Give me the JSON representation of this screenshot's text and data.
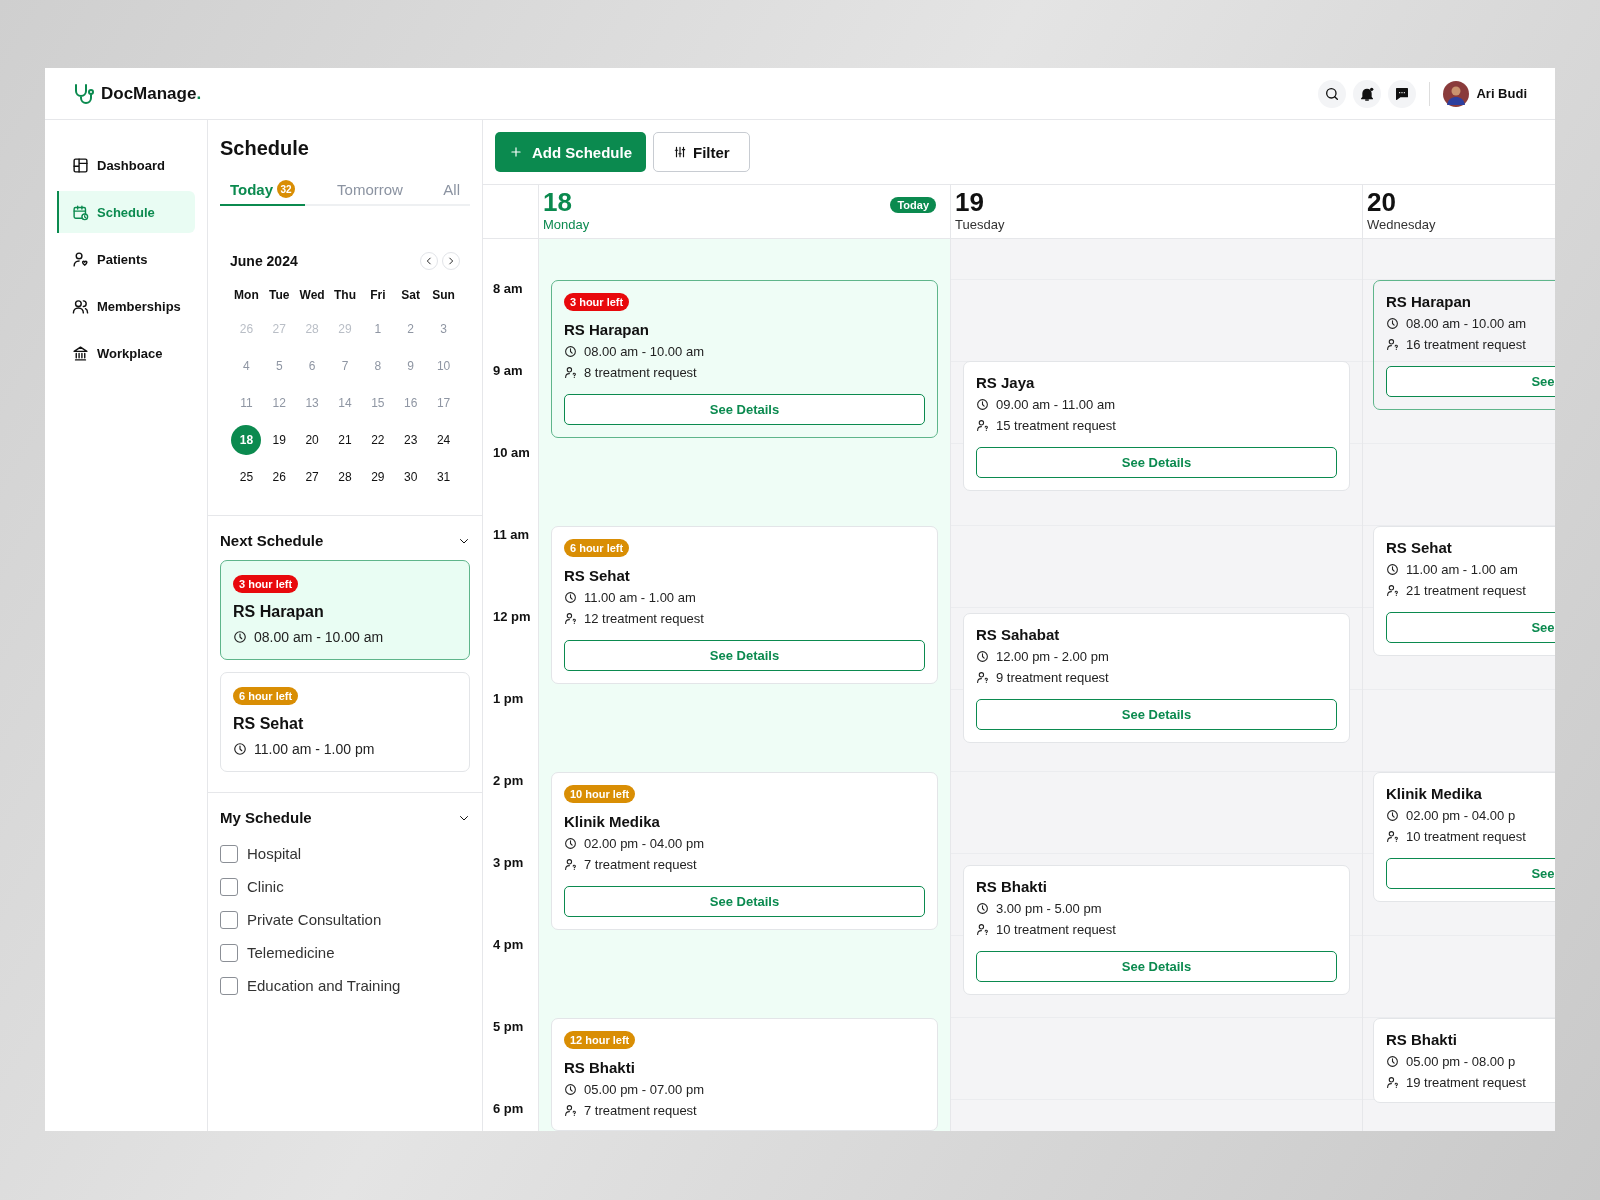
{
  "header": {
    "logo": "DocManage",
    "logo_dot": ".",
    "user": "Ari Budi"
  },
  "sidebar": {
    "items": [
      {
        "label": "Dashboard",
        "kind": "dashboard",
        "selected": false
      },
      {
        "label": "Schedule",
        "kind": "schedule",
        "selected": true
      },
      {
        "label": "Patients",
        "kind": "patients",
        "selected": false
      },
      {
        "label": "Memberships",
        "kind": "memberships",
        "selected": false
      },
      {
        "label": "Workplace",
        "kind": "workplace",
        "selected": false
      }
    ]
  },
  "schedule_panel": {
    "title": "Schedule",
    "tabs": [
      {
        "label": "Today",
        "count": "32",
        "selected": true
      },
      {
        "label": "Tomorrow",
        "selected": false
      },
      {
        "label": "All",
        "selected": false
      }
    ],
    "calendar": {
      "month": "June 2024",
      "weekdays": [
        "Mon",
        "Tue",
        "Wed",
        "Thu",
        "Fri",
        "Sat",
        "Sun"
      ],
      "days": [
        {
          "label": "26",
          "kind": "other",
          "selected": false
        },
        {
          "label": "27",
          "kind": "other",
          "selected": false
        },
        {
          "label": "28",
          "kind": "other",
          "selected": false
        },
        {
          "label": "29",
          "kind": "other",
          "selected": false
        },
        {
          "label": "1",
          "kind": "past",
          "selected": false
        },
        {
          "label": "2",
          "kind": "past",
          "selected": false
        },
        {
          "label": "3",
          "kind": "past",
          "selected": false
        },
        {
          "label": "4",
          "kind": "past",
          "selected": false
        },
        {
          "label": "5",
          "kind": "past",
          "selected": false
        },
        {
          "label": "6",
          "kind": "past",
          "selected": false
        },
        {
          "label": "7",
          "kind": "past",
          "selected": false
        },
        {
          "label": "8",
          "kind": "past",
          "selected": false
        },
        {
          "label": "9",
          "kind": "past",
          "selected": false
        },
        {
          "label": "10",
          "kind": "past",
          "selected": false
        },
        {
          "label": "11",
          "kind": "past",
          "selected": false
        },
        {
          "label": "12",
          "kind": "past",
          "selected": false
        },
        {
          "label": "13",
          "kind": "past",
          "selected": false
        },
        {
          "label": "14",
          "kind": "past",
          "selected": false
        },
        {
          "label": "15",
          "kind": "past",
          "selected": false
        },
        {
          "label": "16",
          "kind": "past",
          "selected": false
        },
        {
          "label": "17",
          "kind": "past",
          "selected": false
        },
        {
          "label": "18",
          "kind": "upcoming",
          "selected": true
        },
        {
          "label": "19",
          "kind": "upcoming",
          "selected": false
        },
        {
          "label": "20",
          "kind": "upcoming",
          "selected": false
        },
        {
          "label": "21",
          "kind": "upcoming",
          "selected": false
        },
        {
          "label": "22",
          "kind": "upcoming",
          "selected": false
        },
        {
          "label": "23",
          "kind": "upcoming",
          "selected": false
        },
        {
          "label": "24",
          "kind": "upcoming",
          "selected": false
        },
        {
          "label": "25",
          "kind": "upcoming",
          "selected": false
        },
        {
          "label": "26",
          "kind": "upcoming",
          "selected": false
        },
        {
          "label": "27",
          "kind": "upcoming",
          "selected": false
        },
        {
          "label": "28",
          "kind": "upcoming",
          "selected": false
        },
        {
          "label": "29",
          "kind": "upcoming",
          "selected": false
        },
        {
          "label": "30",
          "kind": "upcoming",
          "selected": false
        },
        {
          "label": "31",
          "kind": "upcoming",
          "selected": false
        }
      ]
    },
    "next_schedule": {
      "title": "Next Schedule",
      "items": [
        {
          "badge": "3 hour left",
          "color": "#e8090c",
          "name": "RS Harapan",
          "time": "08.00 am - 10.00 am",
          "highlighted": true
        },
        {
          "badge": "6 hour left",
          "color": "#d98e04",
          "name": "RS Sehat",
          "time": "11.00 am - 1.00 pm",
          "highlighted": false
        }
      ]
    },
    "my_schedule": {
      "title": "My Schedule",
      "options": [
        {
          "label": "Hospital",
          "checked": false
        },
        {
          "label": "Clinic",
          "checked": false
        },
        {
          "label": "Private Consultation",
          "checked": false
        },
        {
          "label": "Telemedicine",
          "checked": false
        },
        {
          "label": "Education and Training",
          "checked": false
        }
      ]
    }
  },
  "toolbar": {
    "add_button": "Add Schedule",
    "filter_button": "Filter"
  },
  "calendar_view": {
    "times": [
      "8 am",
      "9 am",
      "10 am",
      "11 am",
      "12 pm",
      "1 pm",
      "2 pm",
      "3 pm",
      "4 pm",
      "5 pm",
      "6 pm"
    ],
    "days": [
      {
        "date": "18",
        "weekday": "Monday",
        "today_badge": "Today",
        "selected": true,
        "events": [
          {
            "badge": "3 hour left",
            "color": "#e8090c",
            "name": "RS Harapan",
            "time": "08.00 am - 10.00 am",
            "requests": "8 treatment request",
            "button": "See Details",
            "highlighted": true
          },
          {
            "badge": "6 hour left",
            "color": "#d98e04",
            "name": "RS Sehat",
            "time": "11.00 am - 1.00 am",
            "requests": "12 treatment request",
            "button": "See Details",
            "highlighted": false
          },
          {
            "badge": "10 hour left",
            "color": "#d98e04",
            "name": "Klinik Medika",
            "time": "02.00 pm - 04.00 pm",
            "requests": "7 treatment request",
            "button": "See Details",
            "highlighted": false
          },
          {
            "badge": "12 hour left",
            "color": "#d98e04",
            "name": "RS Bhakti",
            "time": "05.00 pm - 07.00 pm",
            "requests": "7 treatment request",
            "highlighted": false
          }
        ]
      },
      {
        "date": "19",
        "weekday": "Tuesday",
        "selected": false,
        "events": [
          {
            "name": "RS Jaya",
            "time": "09.00 am - 11.00 am",
            "requests": "15 treatment request",
            "button": "See Details",
            "highlighted": false
          },
          {
            "name": "RS Sahabat",
            "time": "12.00 pm - 2.00 pm",
            "requests": "9 treatment request",
            "button": "See Details",
            "highlighted": false
          },
          {
            "name": "RS Bhakti",
            "time": "3.00 pm - 5.00 pm",
            "requests": "10 treatment request",
            "button": "See Details",
            "highlighted": false
          }
        ]
      },
      {
        "date": "20",
        "weekday": "Wednesday",
        "selected": false,
        "events": [
          {
            "name": "RS Harapan",
            "time": "08.00 am - 10.00 am",
            "requests": "16 treatment request",
            "button": "See",
            "highlighted": true
          },
          {
            "name": "RS Sehat",
            "time": "11.00 am - 1.00 am",
            "requests": "21 treatment request",
            "button": "See",
            "highlighted": false
          },
          {
            "name": "Klinik Medika",
            "time": "02.00 pm - 04.00 p",
            "requests": "10 treatment request",
            "button": "See",
            "highlighted": false
          },
          {
            "name": "RS Bhakti",
            "time": "05.00 pm - 08.00 p",
            "requests": "19 treatment request",
            "highlighted": false
          }
        ]
      }
    ]
  }
}
